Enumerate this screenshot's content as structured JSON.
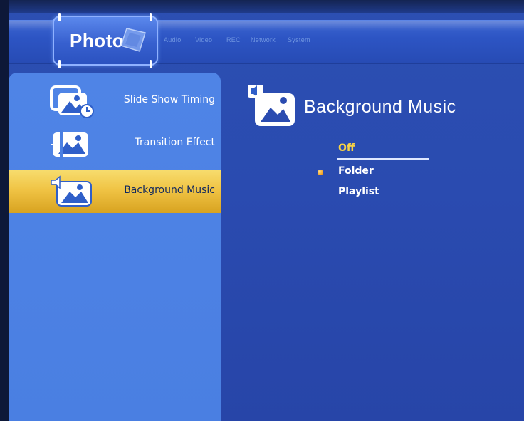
{
  "colors": {
    "background": "#2a4bb0",
    "side_panel": "#4c82e4",
    "selected_item": "#f0c445",
    "focused_option": "#f7d245",
    "text": "#ffffff"
  },
  "tabs": {
    "active": {
      "label": "Photo",
      "icon": "photo-tab-icon"
    },
    "others": [
      {
        "label": "Audio"
      },
      {
        "label": "Video"
      },
      {
        "label": "REC"
      },
      {
        "label": "Network"
      },
      {
        "label": "System"
      }
    ]
  },
  "sidebar": {
    "items": [
      {
        "label": "Slide Show Timing",
        "icon": "slideshow-timing-icon",
        "selected": false
      },
      {
        "label": "Transition Effect",
        "icon": "transition-effect-icon",
        "selected": false
      },
      {
        "label": "Background Music",
        "icon": "background-music-icon",
        "selected": true
      }
    ]
  },
  "content": {
    "title": "Background Music",
    "icon": "background-music-icon",
    "options": [
      {
        "label": "Off",
        "focused": true,
        "active": false
      },
      {
        "label": "Folder",
        "focused": false,
        "active": true
      },
      {
        "label": "Playlist",
        "focused": false,
        "active": false
      }
    ]
  }
}
